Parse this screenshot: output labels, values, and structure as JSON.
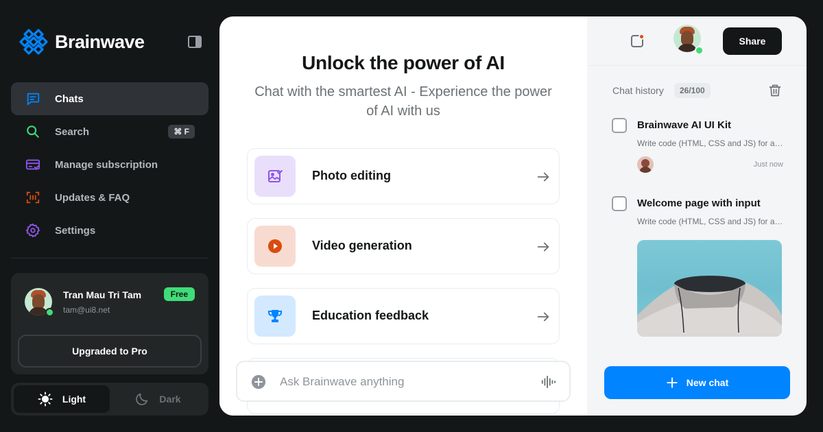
{
  "brand": {
    "name": "Brainwave"
  },
  "nav": {
    "items": [
      {
        "label": "Chats",
        "icon": "chat-icon",
        "color": "#0084ff"
      },
      {
        "label": "Search",
        "icon": "search-icon",
        "color": "#3fdd78",
        "shortcut": "⌘ F"
      },
      {
        "label": "Manage subscription",
        "icon": "card-icon",
        "color": "#8e55ea"
      },
      {
        "label": "Updates & FAQ",
        "icon": "scan-icon",
        "color": "#d84c10"
      },
      {
        "label": "Settings",
        "icon": "gear-icon",
        "color": "#8e55ea"
      }
    ]
  },
  "profile": {
    "name": "Tran Mau Tri Tam",
    "email": "tam@ui8.net",
    "plan": "Free",
    "upgrade_label": "Upgraded to Pro"
  },
  "theme": {
    "light_label": "Light",
    "dark_label": "Dark",
    "selected": "Light"
  },
  "main": {
    "title": "Unlock the power of AI",
    "subtitle": "Chat with the smartest AI - Experience the power of AI with us",
    "features": [
      {
        "label": "Photo editing",
        "icon": "photo-icon",
        "bg": "#e9dffb",
        "color": "#8e55ea"
      },
      {
        "label": "Video generation",
        "icon": "play-icon",
        "bg": "#f8dbd0",
        "color": "#d84c10"
      },
      {
        "label": "Education feedback",
        "icon": "trophy-icon",
        "bg": "#d3e9ff",
        "color": "#0084ff"
      }
    ],
    "input": {
      "placeholder": "Ask Brainwave anything",
      "value": ""
    }
  },
  "right": {
    "share_label": "Share",
    "history": {
      "title": "Chat history",
      "count": "26/100",
      "items": [
        {
          "title": "Brainwave AI UI Kit",
          "snippet": "Write code (HTML, CSS and JS) for a simple form",
          "time": "Just now"
        },
        {
          "title": "Welcome page with input",
          "snippet": "Write code (HTML, CSS and JS) for a welcome page"
        }
      ]
    },
    "new_chat_label": "New chat"
  },
  "colors": {
    "accent": "#0084ff",
    "online": "#3fdd78",
    "free_badge": "#3fdd78",
    "notification": "#d84c10"
  }
}
